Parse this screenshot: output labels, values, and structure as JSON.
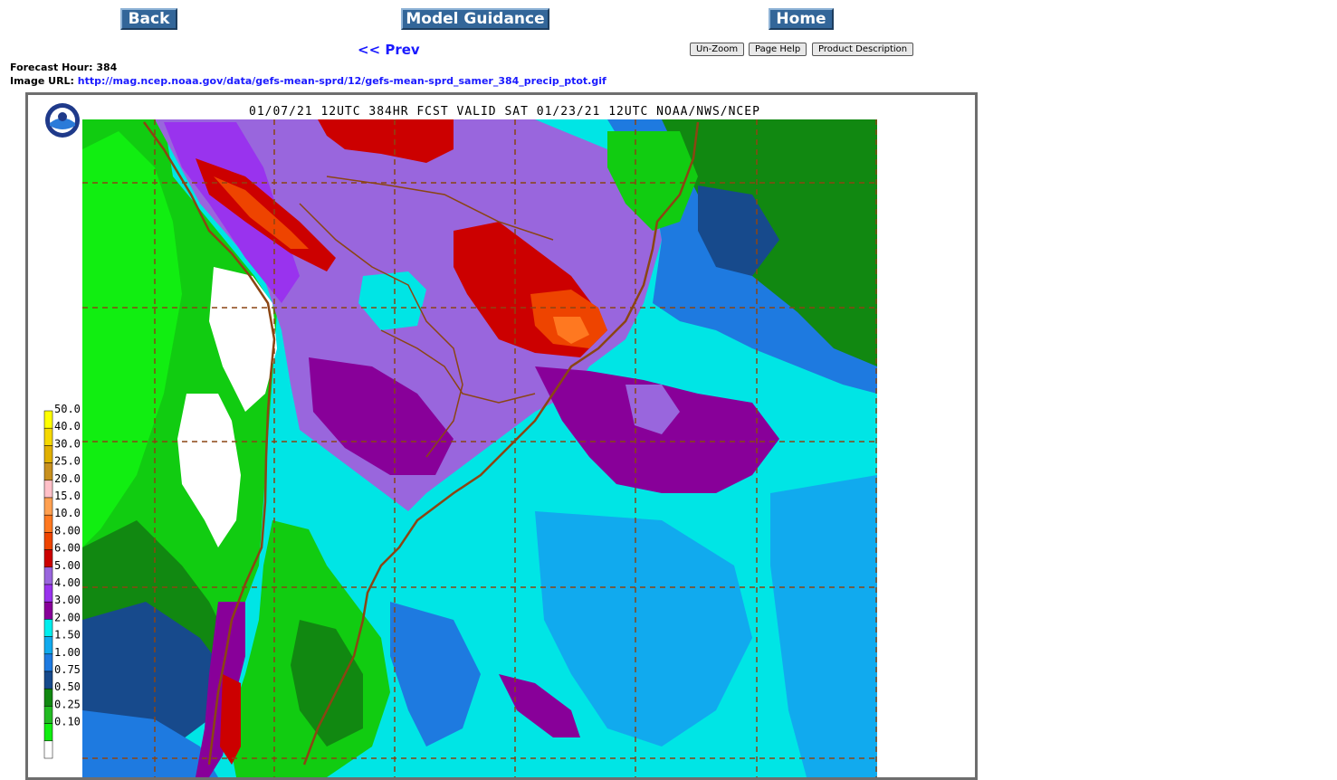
{
  "nav": {
    "back": "Back",
    "model_guidance": "Model Guidance",
    "home": "Home",
    "prev": "<< Prev"
  },
  "tools": {
    "unzoom": "Un-Zoom",
    "page_help": "Page Help",
    "product_description": "Product Description"
  },
  "info": {
    "forecast_hour_label": "Forecast Hour:",
    "forecast_hour": "384",
    "image_url_label": "Image URL:",
    "image_url": "http://mag.ncep.noaa.gov/data/gefs-mean-sprd/12/gefs-mean-sprd_samer_384_precip_ptot.gif"
  },
  "map": {
    "title": "01/07/21 12UTC 384HR FCST VALID SAT 01/23/21 12UTC NOAA/NWS/NCEP",
    "logo_text": "NOAA",
    "legend": [
      {
        "label": "50.0",
        "color": "#ffff00"
      },
      {
        "label": "40.0",
        "color": "#f5d800"
      },
      {
        "label": "30.0",
        "color": "#e0b000"
      },
      {
        "label": "25.0",
        "color": "#c8901e"
      },
      {
        "label": "20.0",
        "color": "#ffc0c8"
      },
      {
        "label": "15.0",
        "color": "#ffa050"
      },
      {
        "label": "10.0",
        "color": "#ff7820"
      },
      {
        "label": "8.00",
        "color": "#ee4400"
      },
      {
        "label": "6.00",
        "color": "#cc0000"
      },
      {
        "label": "5.00",
        "color": "#9966dd"
      },
      {
        "label": "4.00",
        "color": "#9933ee"
      },
      {
        "label": "3.00",
        "color": "#880099"
      },
      {
        "label": "2.00",
        "color": "#00eeee"
      },
      {
        "label": "1.50",
        "color": "#11aaee"
      },
      {
        "label": "1.00",
        "color": "#1e7ae0"
      },
      {
        "label": "0.75",
        "color": "#174a8c"
      },
      {
        "label": "0.50",
        "color": "#118811"
      },
      {
        "label": "0.25",
        "color": "#22bb22"
      },
      {
        "label": "0.10",
        "color": "#11ee11"
      },
      {
        "label": "",
        "color": "#ffffff"
      }
    ]
  }
}
